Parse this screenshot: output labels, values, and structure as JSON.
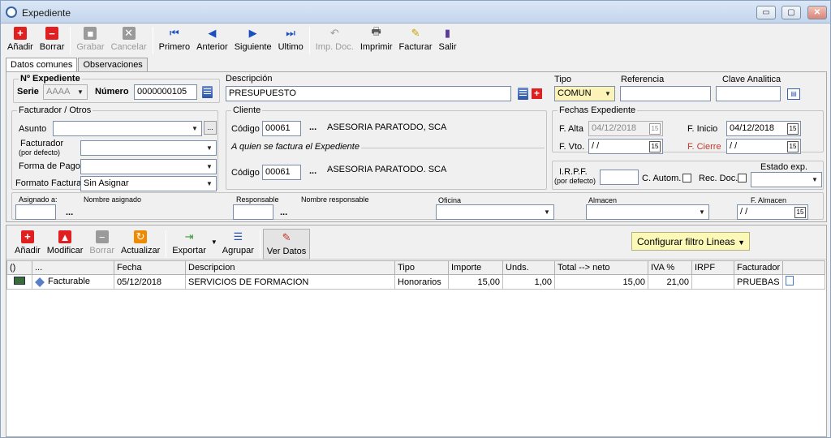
{
  "window": {
    "title": "Expediente",
    "min": "▭",
    "max": "▢",
    "close": "✕"
  },
  "toolbar": [
    {
      "label": "Añadir",
      "icon": "add-icon"
    },
    {
      "label": "Borrar",
      "icon": "delete-icon"
    },
    {
      "label": "Grabar",
      "icon": "save-icon",
      "disabled": true
    },
    {
      "label": "Cancelar",
      "icon": "cancel-icon",
      "disabled": true
    },
    {
      "label": "Primero",
      "icon": "first-icon"
    },
    {
      "label": "Anterior",
      "icon": "prev-icon"
    },
    {
      "label": "Siguiente",
      "icon": "next-icon"
    },
    {
      "label": "Ultimo",
      "icon": "last-icon"
    },
    {
      "label": "Imp. Doc.",
      "icon": "import-doc-icon",
      "disabled": true
    },
    {
      "label": "Imprimir",
      "icon": "print-icon"
    },
    {
      "label": "Facturar",
      "icon": "invoice-icon"
    },
    {
      "label": "Salir",
      "icon": "exit-icon"
    }
  ],
  "tabs": [
    "Datos comunes",
    "Observaciones"
  ],
  "expediente": {
    "group_title": "Nº Expediente",
    "serie_label": "Serie",
    "serie_value": "AAAA",
    "numero_label": "Número",
    "numero_value": "0000000105",
    "descripcion_label": "Descripción",
    "descripcion_value": "PRESUPUESTO",
    "tipo_label": "Tipo",
    "tipo_value": "COMUN",
    "referencia_label": "Referencia",
    "clave_label": "Clave Analitica"
  },
  "facturador": {
    "group_title": "Facturador / Otros",
    "asunto_label": "Asunto",
    "facturador_label": "Facturador",
    "facturador_sub": "(por defecto)",
    "forma_pago_label": "Forma de Pago",
    "formato_label": "Formato Factura",
    "formato_value": "Sin Asignar"
  },
  "cliente": {
    "group_title": "Cliente",
    "codigo_label": "Código",
    "codigo_value": "00061",
    "nombre": "ASESORIA PARATODO, SCA",
    "factura_title": "A quien se factura el Expediente",
    "codigo2_value": "00061",
    "nombre2": "ASESORIA PARATODO. SCA"
  },
  "fechas": {
    "group_title": "Fechas Expediente",
    "alta_label": "F. Alta",
    "alta_value": "04/12/2018",
    "inicio_label": "F. Inicio",
    "inicio_value": "04/12/2018",
    "vto_label": "F. Vto.",
    "vto_value": " /  /",
    "cierre_label": "F. Cierre",
    "cierre_value": " /  /"
  },
  "irpf": {
    "label": "I.R.P.F.",
    "sub": "(por defecto)",
    "autom_label": "C. Autom.",
    "recdoc_label": "Rec. Doc.",
    "estado_label": "Estado exp."
  },
  "bottom": {
    "asignado_label": "Asignado a:",
    "nombre_asignado_label": "Nombre asignado",
    "responsable_label": "Responsable",
    "nombre_resp_label": "Nombre responsable",
    "oficina_label": "Oficina",
    "almacen_label": "Almacen",
    "f_almacen_label": "F. Almacen",
    "f_almacen_value": " /  /",
    "ellipsis": "..."
  },
  "lines_toolbar": [
    {
      "label": "Añadir",
      "icon": "add-icon"
    },
    {
      "label": "Modificar",
      "icon": "edit-icon"
    },
    {
      "label": "Borrar",
      "icon": "delete-icon",
      "disabled": true
    },
    {
      "label": "Actualizar",
      "icon": "refresh-icon"
    },
    {
      "label": "Exportar",
      "icon": "export-icon",
      "dropdown": true
    },
    {
      "label": "Agrupar",
      "icon": "group-icon"
    },
    {
      "label": "Ver Datos",
      "icon": "view-icon"
    }
  ],
  "filter_label": "Configurar filtro Lineas",
  "grid": {
    "columns": [
      "()",
      "...",
      "Fecha",
      "Descripcion",
      "Tipo",
      "Importe",
      "Unds.",
      "Total --> neto",
      "IVA %",
      "IRPF",
      "Facturador",
      ""
    ],
    "rows": [
      [
        "",
        "Facturable",
        "05/12/2018",
        "SERVICIOS DE FORMACION",
        "Honorarios",
        "15,00",
        "1,00",
        "15,00",
        "21,00",
        "",
        "PRUEBAS",
        ""
      ]
    ]
  }
}
